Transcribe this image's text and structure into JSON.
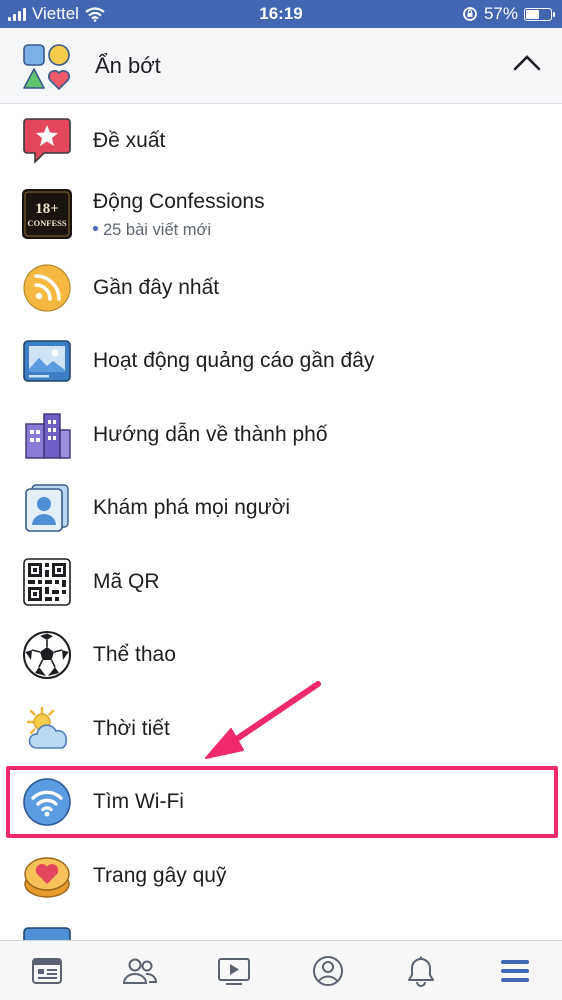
{
  "status_bar": {
    "carrier": "Viettel",
    "time": "16:19",
    "battery": "57%",
    "battery_level": 0.57
  },
  "section": {
    "title": "Ẩn bớt",
    "expanded": true
  },
  "menu_items": [
    {
      "label": "Đề xuất",
      "icon": "recommendation-star-icon"
    },
    {
      "label": "Động Confessions",
      "sublabel": "25 bài viết mới",
      "icon": "confessions-group-avatar"
    },
    {
      "label": "Gần đây nhất",
      "icon": "rss-feed-icon"
    },
    {
      "label": "Hoạt động quảng cáo gần đây",
      "icon": "ad-image-icon"
    },
    {
      "label": "Hướng dẫn về thành phố",
      "icon": "city-buildings-icon"
    },
    {
      "label": "Khám phá mọi người",
      "icon": "people-card-icon"
    },
    {
      "label": "Mã QR",
      "icon": "qr-code-icon"
    },
    {
      "label": "Thể thao",
      "icon": "soccer-ball-icon"
    },
    {
      "label": "Thời tiết",
      "icon": "weather-sun-cloud-icon"
    },
    {
      "label": "Tìm Wi-Fi",
      "icon": "wifi-icon",
      "highlighted": true
    },
    {
      "label": "Trang gây quỹ",
      "icon": "fundraiser-heart-icon"
    }
  ],
  "avatar_text": {
    "line1": "18+",
    "line2": "CONFESS"
  },
  "tab_bar": {
    "tabs": [
      "news-feed-icon",
      "friends-icon",
      "watch-icon",
      "profile-icon",
      "notifications-icon",
      "menu-icon"
    ],
    "active": "menu-icon"
  },
  "colors": {
    "facebook_blue": "#4167b2",
    "annotation_pink": "#ee2a6b",
    "active_tab": "#4267b2"
  }
}
